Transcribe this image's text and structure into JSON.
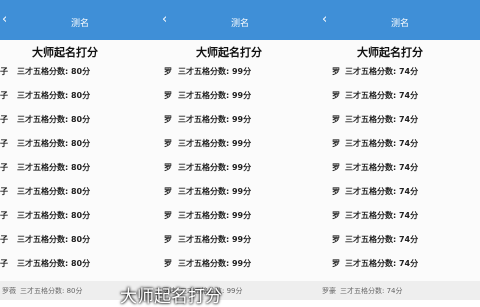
{
  "panels": [
    {
      "nav_title": "测名",
      "back_icon": "back-arrow-icon",
      "banner": "大师起名打分",
      "rows": [
        {
          "name": "子",
          "score": "三才五格分数: 80分"
        },
        {
          "name": "子",
          "score": "三才五格分数: 80分"
        },
        {
          "name": "子",
          "score": "三才五格分数: 80分"
        },
        {
          "name": "子",
          "score": "三才五格分数: 80分"
        },
        {
          "name": "子",
          "score": "三才五格分数: 80分"
        },
        {
          "name": "子",
          "score": "三才五格分数: 80分"
        },
        {
          "name": "子",
          "score": "三才五格分数: 80分"
        },
        {
          "name": "子",
          "score": "三才五格分数: 80分"
        },
        {
          "name": "子",
          "score": "三才五格分数: 80分"
        }
      ],
      "footer": {
        "name": "罗薇",
        "score": "三才五格分数: 80分"
      }
    },
    {
      "nav_title": "测名",
      "back_icon": "back-arrow-icon",
      "banner": "大师起名打分",
      "rows": [
        {
          "name": "罗",
          "score": "三才五格分数: 99分"
        },
        {
          "name": "罗",
          "score": "三才五格分数: 99分"
        },
        {
          "name": "罗",
          "score": "三才五格分数: 99分"
        },
        {
          "name": "罗",
          "score": "三才五格分数: 99分"
        },
        {
          "name": "罗",
          "score": "三才五格分数: 99分"
        },
        {
          "name": "罗",
          "score": "三才五格分数: 99分"
        },
        {
          "name": "罗",
          "score": "三才五格分数: 99分"
        },
        {
          "name": "罗",
          "score": "三才五格分数: 99分"
        },
        {
          "name": "罗",
          "score": "三才五格分数: 99分"
        }
      ],
      "footer": {
        "name": "罗炜",
        "score": "三才五格分数: 99分"
      }
    },
    {
      "nav_title": "测名",
      "back_icon": "back-arrow-icon",
      "banner": "大师起名打分",
      "rows": [
        {
          "name": "罗",
          "score": "三才五格分数: 74分"
        },
        {
          "name": "罗",
          "score": "三才五格分数: 74分"
        },
        {
          "name": "罗",
          "score": "三才五格分数: 74分"
        },
        {
          "name": "罗",
          "score": "三才五格分数: 74分"
        },
        {
          "name": "罗",
          "score": "三才五格分数: 74分"
        },
        {
          "name": "罗",
          "score": "三才五格分数: 74分"
        },
        {
          "name": "罗",
          "score": "三才五格分数: 74分"
        },
        {
          "name": "罗",
          "score": "三才五格分数: 74分"
        },
        {
          "name": "罗",
          "score": "三才五格分数: 74分"
        }
      ],
      "footer": {
        "name": "罗豪",
        "score": "三才五格分数: 74分"
      }
    }
  ],
  "caption": "大师起名打分"
}
